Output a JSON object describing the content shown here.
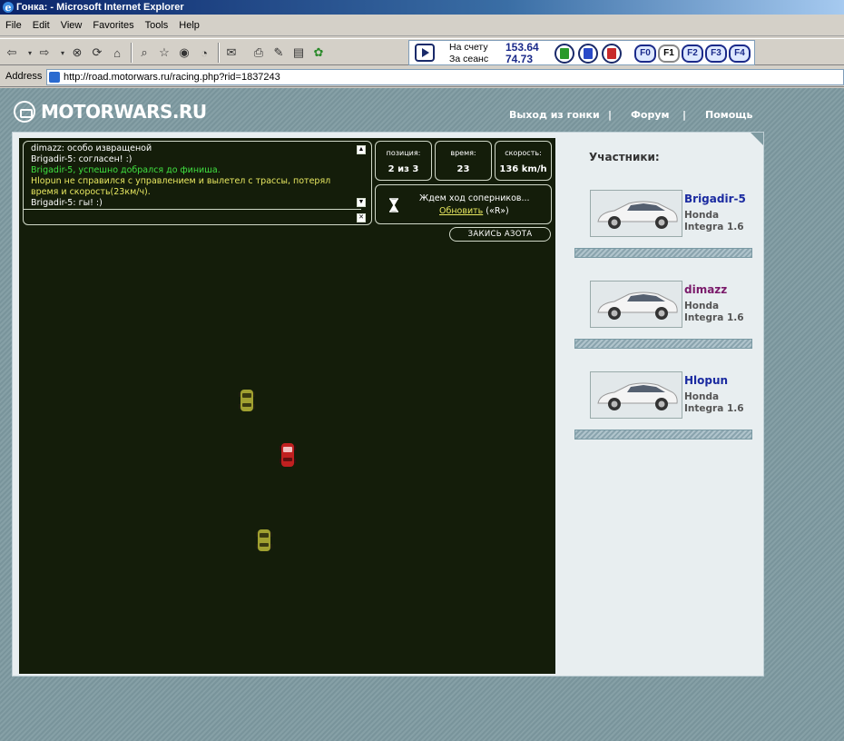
{
  "window": {
    "title": "Гонка: - Microsoft Internet Explorer"
  },
  "menu": {
    "items": [
      {
        "label": "File",
        "key": "F"
      },
      {
        "label": "Edit",
        "key": "E"
      },
      {
        "label": "View",
        "key": "V"
      },
      {
        "label": "Favorites",
        "key": "a"
      },
      {
        "label": "Tools",
        "key": "T"
      },
      {
        "label": "Help",
        "key": "H"
      }
    ]
  },
  "toolbar": {
    "buttons": [
      "back-icon",
      "forward-icon",
      "stop-icon",
      "refresh-icon",
      "home-icon",
      "search-icon",
      "favorites-icon",
      "media-icon",
      "history-icon",
      "mail-icon",
      "print-icon",
      "edit-icon",
      "discuss-icon",
      "messenger-icon"
    ],
    "account": {
      "balance_label": "На счету",
      "balance_value": "153.64",
      "session_label": "За сеанс",
      "session_value": "74.73"
    },
    "trash_colors": [
      "#2a9a2a",
      "#2a4ac8",
      "#c82a2a"
    ],
    "fkeys": [
      {
        "label": "F0",
        "active": false
      },
      {
        "label": "F1",
        "active": true
      },
      {
        "label": "F2",
        "active": false
      },
      {
        "label": "F3",
        "active": false
      },
      {
        "label": "F4",
        "active": false
      }
    ]
  },
  "address": {
    "label": "Address",
    "url": "http://road.motorwars.ru/racing.php?rid=1837243"
  },
  "site": {
    "logo": "MOTORWARS.RU",
    "nav": {
      "exit": "Выход из гонки",
      "sep1": "|",
      "forum": "Форум",
      "sep2": "|",
      "help": "Помощь"
    }
  },
  "chat": {
    "lines": [
      {
        "text": "dimazz: особо извращеной",
        "color": "#ffffff"
      },
      {
        "text": "Brigadir-5: согласен! :)",
        "color": "#ffffff"
      },
      {
        "text": "Brigadir-5, успешно добрался до финиша.",
        "color": "#40e040"
      },
      {
        "text": "Hlopun не справился с управлением и вылетел с трассы, потерял время и скорость(23км/ч).",
        "color": "#e8e860"
      },
      {
        "text": "Brigadir-5: гы! :)",
        "color": "#ffffff"
      }
    ]
  },
  "race": {
    "position_label": "позиция:",
    "position_value": "2 из 3",
    "time_label": "время:",
    "time_value": "23",
    "speed_label": "скорость:",
    "speed_value": "136 km/h",
    "wait_text": "Ждем ход соперников...",
    "refresh_link": "Обновить",
    "refresh_hotkey": "(«R»)",
    "nitro_button": "ЗАКИСЬ АЗОТА"
  },
  "participants": {
    "title": "Участники:",
    "list": [
      {
        "name": "Brigadir-5",
        "color": "#1a2aa0",
        "car_make": "Honda",
        "car_model": "Integra 1.6"
      },
      {
        "name": "dimazz",
        "color": "#7a1a6a",
        "car_make": "Honda",
        "car_model": "Integra 1.6"
      },
      {
        "name": "Hlopun",
        "color": "#1a2aa0",
        "car_make": "Honda",
        "car_model": "Integra 1.6"
      }
    ]
  },
  "colors": {
    "page_bg": "#7e9aa1",
    "track_bg": "#141d0a",
    "title_bar": "#0a246a"
  }
}
